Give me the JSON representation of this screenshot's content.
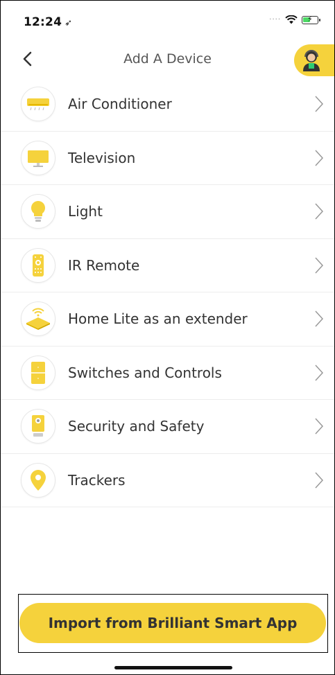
{
  "status_bar": {
    "time": "12:24",
    "location_arrow": "➤"
  },
  "nav": {
    "title": "Add A Device",
    "back_icon": "chevron-left-icon",
    "support_icon": "support-agent-icon"
  },
  "devices": [
    {
      "label": "Air Conditioner",
      "icon": "air-conditioner-icon"
    },
    {
      "label": "Television",
      "icon": "television-icon"
    },
    {
      "label": "Light",
      "icon": "light-bulb-icon"
    },
    {
      "label": "IR Remote",
      "icon": "ir-remote-icon"
    },
    {
      "label": "Home Lite as an extender",
      "icon": "home-lite-icon"
    },
    {
      "label": "Switches and Controls",
      "icon": "switch-icon"
    },
    {
      "label": "Security and Safety",
      "icon": "security-camera-icon"
    },
    {
      "label": "Trackers",
      "icon": "tracker-pin-icon"
    }
  ],
  "import_button": {
    "label": "Import from Brilliant Smart App"
  },
  "colors": {
    "accent": "#f5d23c",
    "text": "#333333",
    "divider": "#ececec"
  }
}
